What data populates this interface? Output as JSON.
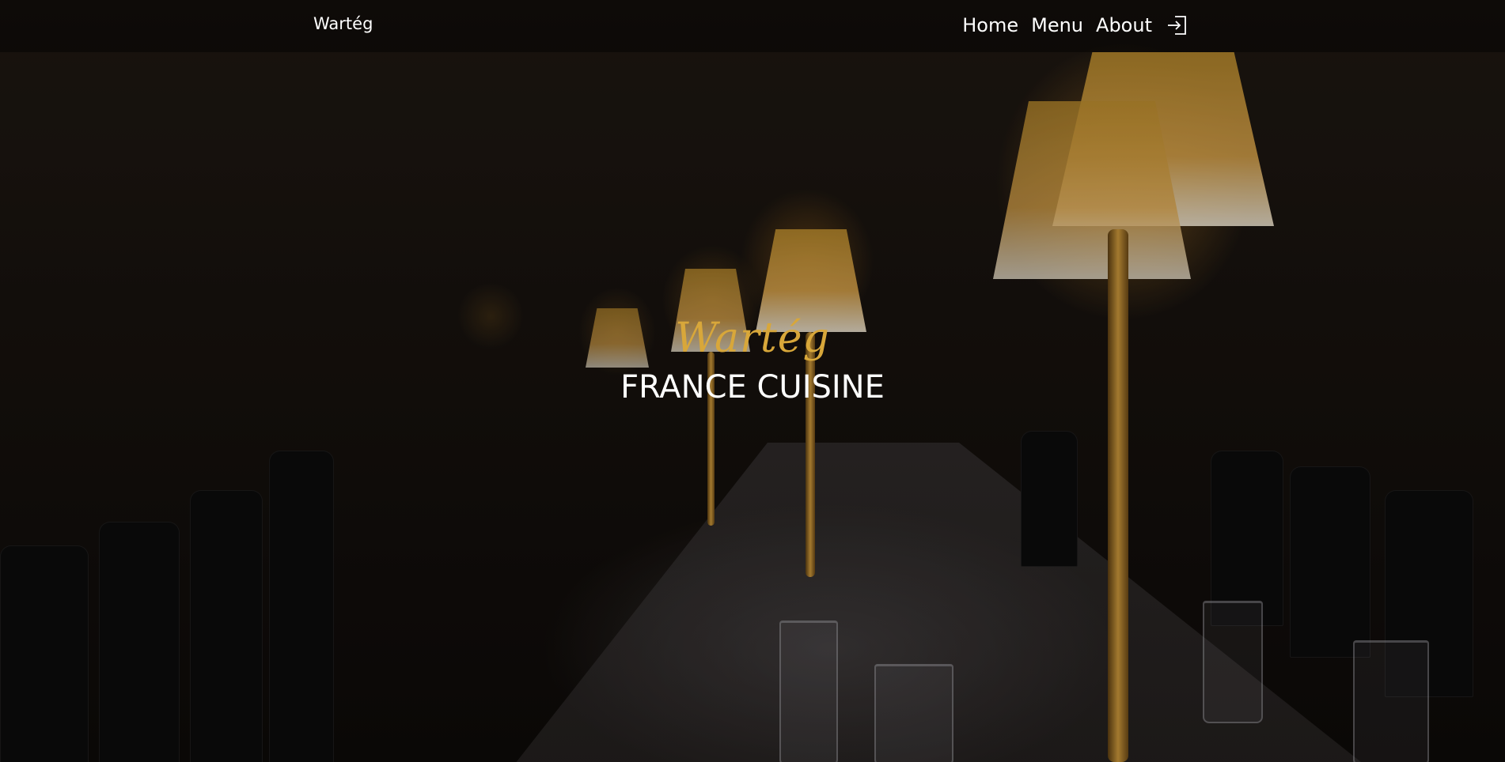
{
  "navbar": {
    "brand": "Wartég",
    "links": [
      {
        "label": "Home"
      },
      {
        "label": "Menu"
      },
      {
        "label": "About"
      }
    ],
    "login_icon": "login-icon"
  },
  "hero": {
    "script_title": "Wartég",
    "main_title": "FRANCE CUISINE",
    "background": "restaurant-dining-hall-photo",
    "accent_color": "#d8a73a"
  }
}
